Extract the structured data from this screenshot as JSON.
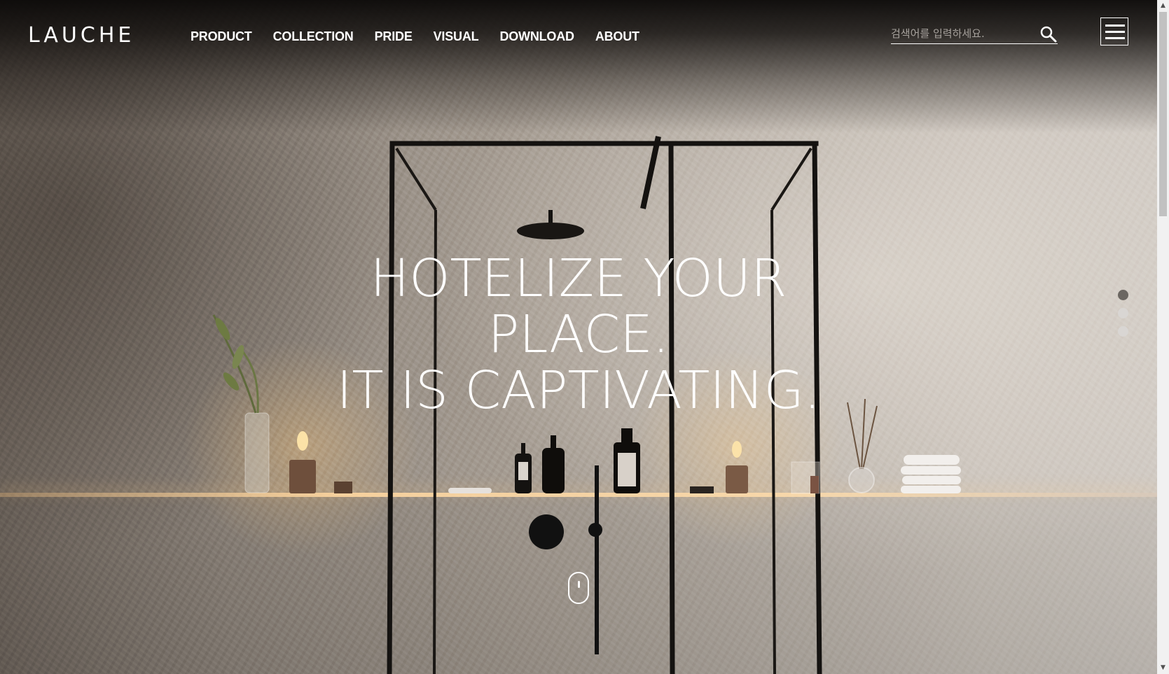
{
  "header": {
    "logo_text": "LAUCHE",
    "nav": [
      {
        "label": "PRODUCT"
      },
      {
        "label": "COLLECTION"
      },
      {
        "label": "PRIDE"
      },
      {
        "label": "VISUAL"
      },
      {
        "label": "DOWNLOAD"
      },
      {
        "label": "ABOUT"
      }
    ],
    "search": {
      "placeholder": "검색어를 입력하세요.",
      "value": ""
    },
    "icons": {
      "search": "search-icon",
      "menu": "hamburger-menu-icon"
    }
  },
  "hero": {
    "lines": [
      "HOTELIZE YOUR",
      "PLACE.",
      "IT IS CAPTIVATING."
    ]
  },
  "slider": {
    "count": 3,
    "active_index": 0,
    "active_color": "#6b6661",
    "inactive_color": "#d9d6d3"
  },
  "scroll_indicator": {
    "icon": "mouse-scroll-icon"
  },
  "scrollbar": {
    "up_arrow": "▲",
    "down_arrow": "▼"
  }
}
